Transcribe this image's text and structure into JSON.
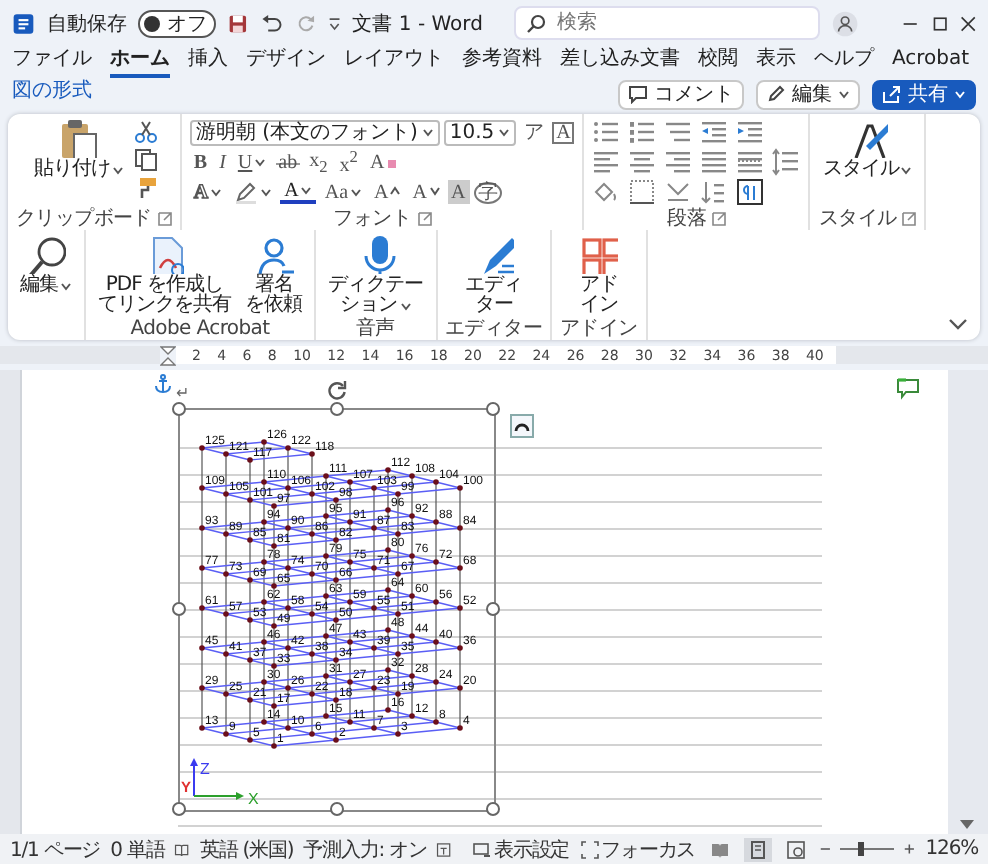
{
  "title_bar": {
    "autosave_label": "自動保存",
    "autosave_toggle": {
      "label": "オフ",
      "on": false
    },
    "document_title": "文書 1 - Word",
    "search": {
      "placeholder": "検索"
    }
  },
  "menu_tabs": [
    {
      "label": "ファイル",
      "selected": false,
      "kind": "standard"
    },
    {
      "label": "ホーム",
      "selected": true,
      "kind": "standard"
    },
    {
      "label": "挿入",
      "selected": false,
      "kind": "standard"
    },
    {
      "label": "デザイン",
      "selected": false,
      "kind": "standard"
    },
    {
      "label": "レイアウト",
      "selected": false,
      "kind": "standard"
    },
    {
      "label": "参考資料",
      "selected": false,
      "kind": "standard"
    },
    {
      "label": "差し込み文書",
      "selected": false,
      "kind": "standard"
    },
    {
      "label": "校閲",
      "selected": false,
      "kind": "standard"
    },
    {
      "label": "表示",
      "selected": false,
      "kind": "standard"
    },
    {
      "label": "ヘルプ",
      "selected": false,
      "kind": "standard"
    },
    {
      "label": "Acrobat",
      "selected": false,
      "kind": "standard"
    },
    {
      "label": "図の形式",
      "selected": false,
      "kind": "contextual"
    }
  ],
  "header_buttons": [
    {
      "label": "コメント",
      "kind": "comment"
    },
    {
      "label": "編集",
      "kind": "editing"
    },
    {
      "label": "共有",
      "kind": "share"
    }
  ],
  "ribbon": {
    "groups": [
      {
        "label": "クリップボード",
        "kind": "clipboard",
        "dialog_launcher": true,
        "buttons": [
          {
            "lines": [
              "貼り付け"
            ],
            "kind": "paste",
            "dropdown": true
          }
        ]
      },
      {
        "label": "フォント",
        "kind": "font",
        "dialog_launcher": true,
        "font_name": "游明朝 (本文のフォント)",
        "font_size": "10.5",
        "row_1": [
          {
            "text": "ア",
            "kind": "phonetic",
            "dropdown": false
          },
          {
            "text": "A",
            "kind": "boxed",
            "dropdown": false
          }
        ],
        "row_2": [
          {
            "text": "B",
            "kind": "bold",
            "dropdown": false
          },
          {
            "text": "I",
            "kind": "italic",
            "dropdown": false
          },
          {
            "text": "U",
            "kind": "underline",
            "dropdown": true
          },
          {
            "text": "ab",
            "kind": "strike",
            "dropdown": false
          },
          {
            "text": "x$_{2}$",
            "kind": "subscript",
            "dropdown": false
          },
          {
            "text": "x$^{2}$",
            "kind": "superscript",
            "dropdown": false
          },
          {
            "text": "A",
            "kind": "clear",
            "dropdown": false
          }
        ],
        "row_3": [
          {
            "text": "A",
            "kind": "effects",
            "dropdown": true
          },
          {
            "kind": "highlight",
            "dropdown": true
          },
          {
            "text": "A",
            "kind": "fontcolor",
            "dropdown": true
          },
          {
            "text": "Aa",
            "kind": "case",
            "dropdown": true
          },
          {
            "text": "A",
            "kind": "grow",
            "dropdown": false
          },
          {
            "text": "A",
            "kind": "shrink",
            "dropdown": false
          },
          {
            "text": "A",
            "kind": "shaded",
            "dropdown": false
          },
          {
            "text": "字",
            "kind": "enclosed",
            "dropdown": false
          }
        ]
      },
      {
        "label": "段落",
        "kind": "paragraph",
        "dialog_launcher": true
      },
      {
        "label": "スタイル",
        "kind": "buttons",
        "dialog_launcher": true,
        "buttons": [
          {
            "lines": [
              "スタイル"
            ],
            "kind": "styles",
            "dropdown": true
          }
        ]
      },
      {
        "kind": "buttons",
        "dialog_launcher": false,
        "buttons": [
          {
            "lines": [
              "編集"
            ],
            "kind": "find",
            "dropdown": true
          }
        ]
      },
      {
        "label": "Adobe Acrobat",
        "kind": "buttons",
        "dialog_launcher": false,
        "buttons": [
          {
            "lines": [
              "PDF を作成し",
              "てリンクを共有"
            ],
            "kind": "pdf",
            "dropdown": false
          },
          {
            "lines": [
              "署名",
              "を依頼"
            ],
            "kind": "signature",
            "dropdown": false
          }
        ]
      },
      {
        "label": "音声",
        "kind": "buttons",
        "dialog_launcher": false,
        "buttons": [
          {
            "lines": [
              "ディクテー",
              "ション"
            ],
            "kind": "dictate",
            "dropdown": true
          }
        ]
      },
      {
        "label": "エディター",
        "kind": "buttons",
        "dialog_launcher": false,
        "buttons": [
          {
            "lines": [
              "エディ",
              "ター"
            ],
            "kind": "editor",
            "dropdown": false
          }
        ]
      },
      {
        "label": "アドイン",
        "kind": "buttons",
        "dialog_launcher": false,
        "buttons": [
          {
            "lines": [
              "アド",
              "イン"
            ],
            "kind": "addins",
            "dropdown": false
          }
        ]
      }
    ]
  },
  "ruler": {
    "numbers": [
      "2",
      "4",
      "6",
      "8",
      "10",
      "12",
      "14",
      "16",
      "18",
      "20",
      "22",
      "24",
      "26",
      "28",
      "30",
      "32",
      "34",
      "36",
      "38",
      "40"
    ]
  },
  "document": {
    "paragraph_mark": "↵",
    "image": {
      "selected": true,
      "model": {
        "levels": [
          {
            "nodes": [
              "125",
              "126",
              "121",
              "122",
              "117",
              "118"
            ]
          },
          {
            "nodes": [
              "109",
              "110",
              "111",
              "112",
              "105",
              "106",
              "107",
              "108",
              "101",
              "102",
              "103",
              "104",
              "97",
              "98",
              "99",
              "100"
            ]
          },
          {
            "nodes": [
              "93",
              "94",
              "95",
              "96",
              "89",
              "90",
              "91",
              "92",
              "85",
              "86",
              "87",
              "88",
              "81",
              "82",
              "83",
              "84"
            ]
          },
          {
            "nodes": [
              "77",
              "78",
              "79",
              "80",
              "73",
              "74",
              "75",
              "76",
              "69",
              "70",
              "71",
              "72",
              "65",
              "66",
              "67",
              "68"
            ]
          },
          {
            "nodes": [
              "61",
              "62",
              "63",
              "64",
              "57",
              "58",
              "59",
              "60",
              "53",
              "54",
              "55",
              "56",
              "49",
              "50",
              "51",
              "52"
            ]
          },
          {
            "nodes": [
              "45",
              "46",
              "47",
              "48",
              "41",
              "42",
              "43",
              "44",
              "37",
              "38",
              "39",
              "40",
              "33",
              "34",
              "35",
              "36"
            ]
          },
          {
            "nodes": [
              "29",
              "30",
              "31",
              "32",
              "25",
              "26",
              "27",
              "28",
              "21",
              "22",
              "23",
              "24",
              "17",
              "18",
              "19",
              "20"
            ]
          },
          {
            "nodes": [
              "13",
              "14",
              "15",
              "16",
              "9",
              "10",
              "11",
              "12",
              "5",
              "6",
              "7",
              "8",
              "1",
              "2",
              "3",
              "4"
            ]
          }
        ]
      },
      "axes": [
        {
          "label": "Z",
          "kind": "z",
          "color": "#3b3bf0"
        },
        {
          "label": "X",
          "kind": "x",
          "color": "#2ca02c"
        },
        {
          "label": "Y",
          "kind": "y",
          "color": "#e03030"
        }
      ]
    }
  },
  "status_bar": {
    "page": "1/1 ページ",
    "words": "0 単語",
    "language": "英語 (米国)",
    "text_prediction": "予測入力: オン",
    "display_settings": "表示設定",
    "focus": "フォーカス",
    "views": [
      {
        "kind": "read",
        "selected": false
      },
      {
        "kind": "print",
        "selected": true
      },
      {
        "kind": "web",
        "selected": false
      }
    ],
    "zoom": {
      "level": 0.35,
      "reading": "126%"
    }
  }
}
